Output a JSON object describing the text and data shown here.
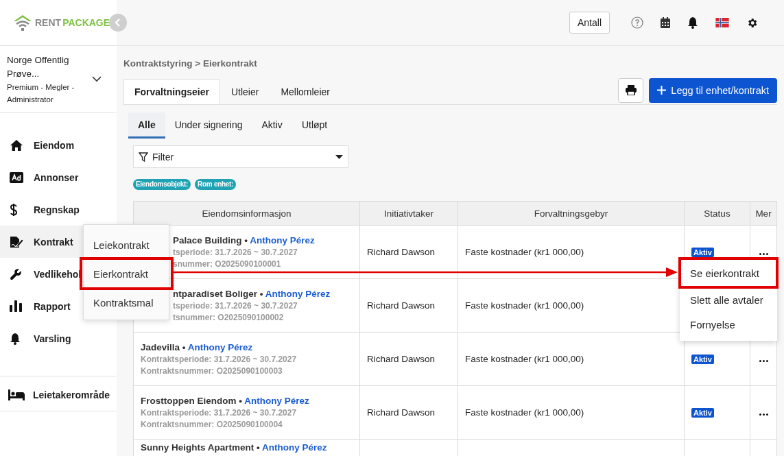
{
  "logo": {
    "part1": "RENT",
    "part2": "PACKAGE"
  },
  "org": {
    "name": "Norge Offentlig Prøve...",
    "role": "Premium - Megler - Administrator"
  },
  "nav": [
    {
      "label": "Eiendom",
      "selected": false
    },
    {
      "label": "Annonser",
      "selected": false
    },
    {
      "label": "Regnskap",
      "selected": false
    },
    {
      "label": "Kontrakt",
      "selected": true
    },
    {
      "label": "Vedlikehol",
      "selected": false
    },
    {
      "label": "Rapport",
      "selected": false
    },
    {
      "label": "Varsling",
      "selected": false
    }
  ],
  "tenant_area": {
    "label": "Leietakerområde"
  },
  "header": {
    "count_button": "Antall"
  },
  "breadcrumb": "Kontraktstyring > Eierkontrakt",
  "tabs": [
    {
      "label": "Forvaltningseier",
      "selected": true
    },
    {
      "label": "Utleier",
      "selected": false
    },
    {
      "label": "Mellomleier",
      "selected": false
    }
  ],
  "add_button": "Legg til enhet/kontrakt",
  "subtabs": [
    {
      "label": "Alle",
      "selected": true
    },
    {
      "label": "Under signering",
      "selected": false
    },
    {
      "label": "Aktiv",
      "selected": false
    },
    {
      "label": "Utløpt",
      "selected": false
    }
  ],
  "filter": {
    "placeholder": "Filter"
  },
  "chips": [
    "Eiendomsobjekt:",
    "Rom enhet:"
  ],
  "table": {
    "columns": [
      "Eiendomsinformasjon",
      "Initiativtaker",
      "Forvaltningsgebyr",
      "Status",
      "Mer"
    ],
    "rows": [
      {
        "partly_covered": true,
        "title": "Palace Building •",
        "owner": "Anthony Pérez",
        "period": "tsperiode: 31.7.2026 ~ 30.7.2027",
        "number": "snummer: O2025090100001",
        "initiator": "Richard Dawson",
        "fee": "Faste kostnader (kr1 000,00)",
        "status": "Aktiv",
        "more": true
      },
      {
        "partly_covered": true,
        "title": "ntparadiset Boliger •",
        "owner": "Anthony Pérez",
        "period": "tsperiode: 31.7.2026 ~ 30.7.2027",
        "number": "tsnummer: O2025090100002",
        "initiator": "Richard Dawson",
        "fee": "Faste kostnader (kr1 000,00)"
      },
      {
        "partly_covered": false,
        "title": "Jadevilla •",
        "owner": "Anthony Pérez",
        "period": "Kontraktsperiode: 31.7.2026 ~ 30.7.2027",
        "number": "Kontraktsnummer: O2025090100003",
        "initiator": "Richard Dawson",
        "fee": "Faste kostnader (kr1 000,00)",
        "status": "Aktiv",
        "more": true
      },
      {
        "partly_covered": false,
        "title": "Frosttoppen Eiendom •",
        "owner": "Anthony Pérez",
        "period": "Kontraktsperiode: 31.7.2026 ~ 30.7.2027",
        "number": "Kontraktsnummer: O2025090100004",
        "initiator": "Richard Dawson",
        "fee": "Faste kostnader (kr1 000,00)",
        "status": "Aktiv",
        "more": true
      },
      {
        "partly_covered": false,
        "title": "Sunny Heights Apartment •",
        "owner": "Anthony Pérez"
      }
    ]
  },
  "submenu": [
    {
      "label": "Leiekontrakt",
      "highlighted": false
    },
    {
      "label": "Eierkontrakt",
      "highlighted": true
    },
    {
      "label": "Kontraktsmal",
      "highlighted": false
    }
  ],
  "row_menu": [
    {
      "label": "Se eierkontrakt",
      "highlighted": true
    },
    {
      "label": "Slett alle avtaler",
      "highlighted": false
    },
    {
      "label": "Fornyelse",
      "highlighted": false
    }
  ]
}
